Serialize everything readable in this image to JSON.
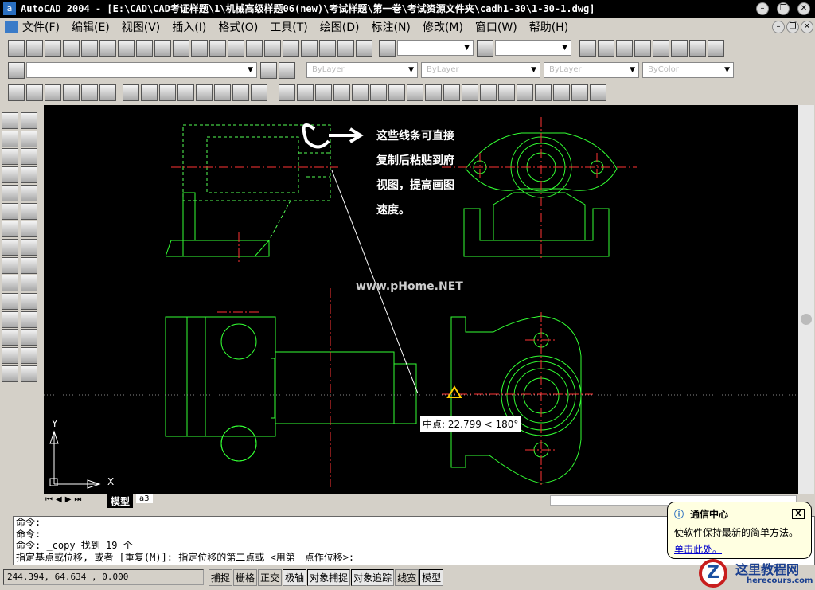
{
  "window": {
    "title": "AutoCAD 2004 - [E:\\CAD\\CAD考证样题\\1\\机械高级样题06(new)\\考试样题\\第一卷\\考试资源文件夹\\cadh1-30\\1-30-1.dwg]",
    "app_icon": "a",
    "controls": [
      "minimize-icon",
      "restore-icon",
      "close-icon"
    ]
  },
  "menu": [
    "文件(F)",
    "编辑(E)",
    "视图(V)",
    "插入(I)",
    "格式(O)",
    "工具(T)",
    "绘图(D)",
    "标注(N)",
    "修改(M)",
    "窗口(W)",
    "帮助(H)"
  ],
  "toolbars": {
    "standard": [
      "new",
      "open",
      "save",
      "print",
      "print-preview",
      "publish",
      "cut",
      "copy",
      "paste",
      "match-properties",
      "undo",
      "redo",
      "pan-realtime",
      "zoom-realtime",
      "zoom-window",
      "zoom-previous",
      "properties",
      "design-center",
      "tool-palettes",
      "help"
    ],
    "styles": [
      "text-style",
      "dim-style"
    ],
    "zoom": [
      "zoom-in",
      "zoom-window",
      "zoom-extents",
      "zoom-all",
      "zoom-plus",
      "zoom-minus",
      "zoom-scale",
      "zoom-center"
    ],
    "layers": {
      "layer_icons": [
        "layer-manager",
        "bulb",
        "sun",
        "lock",
        "color"
      ],
      "combos": [
        "ByLayer",
        "ByLayer",
        "ByLayer",
        "ByColor"
      ]
    },
    "solids": [
      "box",
      "sphere",
      "cylinder",
      "cone",
      "wedge",
      "torus",
      "extrude",
      "revolve",
      "slice",
      "section",
      "interfere",
      "setup-drawing",
      "setup-view",
      "setup-profile"
    ],
    "solidedit": [
      "union",
      "subtract",
      "intersect",
      "extrude-faces",
      "move-faces",
      "offset-faces",
      "delete-faces",
      "rotate-faces",
      "taper-faces",
      "copy-faces",
      "color-faces",
      "copy-edges",
      "color-edges",
      "imprint",
      "clean",
      "separate",
      "shell",
      "check"
    ],
    "draw": [
      "line",
      "pencil",
      "polyline",
      "move",
      "polygon",
      "mirror",
      "rectangle",
      "offset",
      "arc",
      "array",
      "circle",
      "rotate",
      "revision-cloud",
      "scale",
      "spline",
      "stretch",
      "ellipse",
      "trim",
      "ellipse-arc",
      "extend",
      "insert-block",
      "break",
      "make-block",
      "chamfer",
      "point",
      "fillet",
      "hatch",
      "explode",
      "region",
      "text"
    ]
  },
  "drawing": {
    "annotation": [
      "这些线条可直接",
      "复制后粘贴到府",
      "视图，提高画图",
      "速度。"
    ],
    "watermark": "www.pHome.NET",
    "tooltip": "中点: 22.799 < 180°",
    "axis_x": "X",
    "axis_y": "Y",
    "colors": {
      "outline": "#33ff33",
      "center": "#ff3333",
      "hidden": "#ffff55"
    }
  },
  "tabs": [
    "模型",
    "a3"
  ],
  "command": {
    "lines": [
      "命令:",
      "命令:",
      "命令: _copy 找到 19 个",
      "指定基点或位移, 或者 [重复(M)]: 指定位移的第二点或 <用第一点作位移>:"
    ]
  },
  "status": {
    "coords": "244.394, 64.634 , 0.000",
    "buttons": [
      {
        "label": "捕捉",
        "on": false
      },
      {
        "label": "栅格",
        "on": false
      },
      {
        "label": "正交",
        "on": false
      },
      {
        "label": "极轴",
        "on": true
      },
      {
        "label": "对象捕捉",
        "on": true
      },
      {
        "label": "对象追踪",
        "on": true
      },
      {
        "label": "线宽",
        "on": false
      },
      {
        "label": "模型",
        "on": true
      }
    ]
  },
  "balloon": {
    "title": "通信中心",
    "body": "使软件保持最新的简单方法。",
    "link": "单击此处。"
  },
  "logo": {
    "name": "这里教程网",
    "url": "herecours.com"
  }
}
